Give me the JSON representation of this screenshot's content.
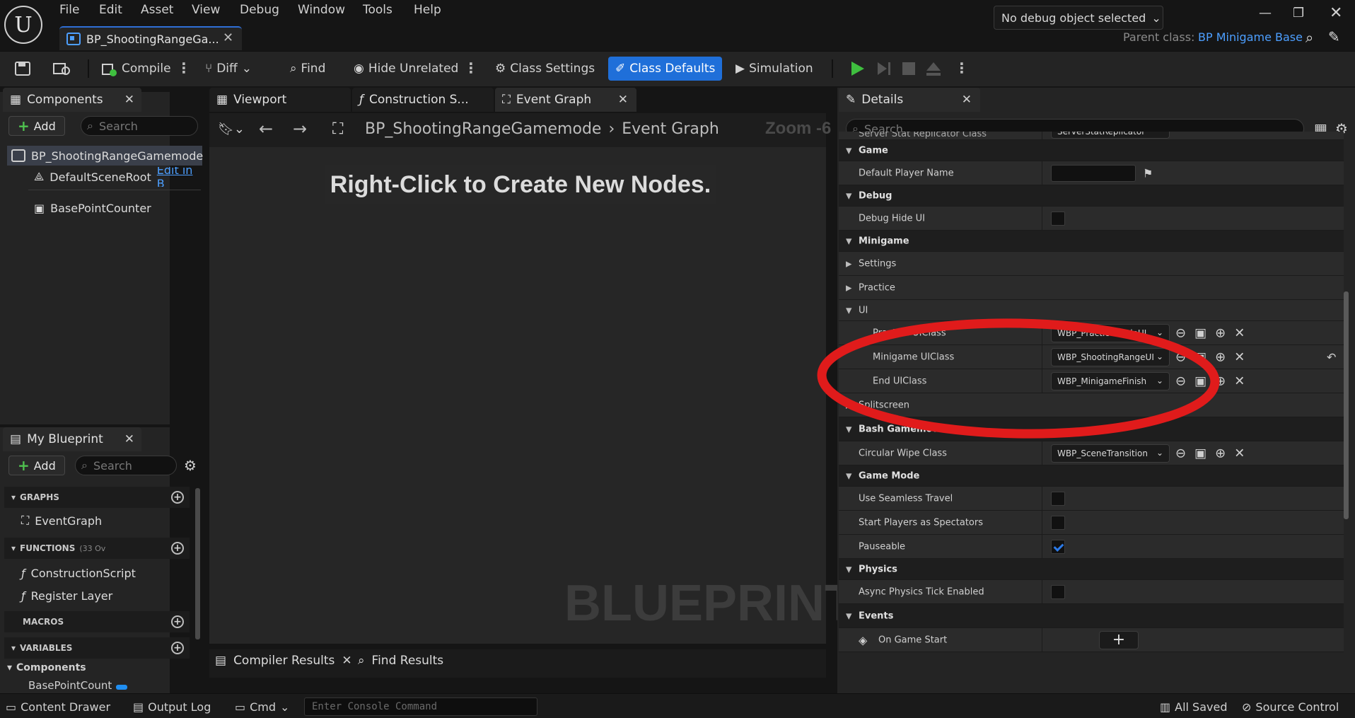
{
  "menu": [
    "File",
    "Edit",
    "Asset",
    "View",
    "Debug",
    "Window",
    "Tools",
    "Help"
  ],
  "document_tab": {
    "title": "BP_ShootingRangeGa..."
  },
  "parent_class": {
    "label": "Parent class:",
    "value": "BP Minigame Base"
  },
  "toolbar": {
    "compile": "Compile",
    "diff": "Diff",
    "find": "Find",
    "hide_unrelated": "Hide Unrelated",
    "class_settings": "Class Settings",
    "class_defaults": "Class Defaults",
    "simulation": "Simulation",
    "debug_object": "No debug object selected"
  },
  "components": {
    "tab": "Components",
    "add": "Add",
    "search_placeholder": "Search",
    "items": [
      "BP_ShootingRangeGamemode",
      "DefaultSceneRoot",
      "BasePointCounter"
    ],
    "edit_link": "Edit in B"
  },
  "my_blueprint": {
    "tab": "My Blueprint",
    "add": "Add",
    "search_placeholder": "Search",
    "graphs_label": "GRAPHS",
    "graphs": [
      "EventGraph"
    ],
    "functions_label": "FUNCTIONS",
    "functions_count": "(33 Ov",
    "functions": [
      "ConstructionScript",
      "Register Layer"
    ],
    "macros_label": "MACROS",
    "variables_label": "VARIABLES",
    "components_label": "Components",
    "component_vars": [
      "BasePointCount"
    ]
  },
  "graph_tabs": [
    "Viewport",
    "Construction S...",
    "Event Graph"
  ],
  "graph": {
    "breadcrumb_root": "BP_ShootingRangeGamemode",
    "breadcrumb_leaf": "Event Graph",
    "zoom": "Zoom -6",
    "hint": "Right-Click to Create New Nodes.",
    "watermark": "BLUEPRINT"
  },
  "bottom_tabs": [
    "Compiler Results",
    "Find Results"
  ],
  "details": {
    "tab": "Details",
    "search_placeholder": "Search",
    "rows": [
      {
        "type": "partial",
        "name": "Server Stat Replicator Class",
        "value": "ServerStatReplicator"
      },
      {
        "type": "cat",
        "name": "Game"
      },
      {
        "type": "prop",
        "name": "Default Player Name",
        "widget": "text"
      },
      {
        "type": "cat",
        "name": "Debug"
      },
      {
        "type": "prop",
        "name": "Debug Hide UI",
        "widget": "check",
        "checked": false
      },
      {
        "type": "cat",
        "name": "Minigame"
      },
      {
        "type": "sub",
        "name": "Settings"
      },
      {
        "type": "sub",
        "name": "Practice"
      },
      {
        "type": "subopen",
        "name": "UI"
      },
      {
        "type": "prop2",
        "name": "Practice UIClass",
        "widget": "combo",
        "value": "WBP_PracticeModeUI"
      },
      {
        "type": "prop2",
        "name": "Minigame UIClass",
        "widget": "combo",
        "value": "WBP_ShootingRangeUI",
        "reset": true
      },
      {
        "type": "prop2",
        "name": "End UIClass",
        "widget": "combo",
        "value": "WBP_MinigameFinish"
      },
      {
        "type": "sub",
        "name": "Splitscreen"
      },
      {
        "type": "cat",
        "name": "Bash Gamemode"
      },
      {
        "type": "prop",
        "name": "Circular Wipe Class",
        "widget": "combo",
        "value": "WBP_SceneTransition"
      },
      {
        "type": "cat",
        "name": "Game Mode"
      },
      {
        "type": "prop",
        "name": "Use Seamless Travel",
        "widget": "check",
        "checked": false
      },
      {
        "type": "prop",
        "name": "Start Players as Spectators",
        "widget": "check",
        "checked": false
      },
      {
        "type": "prop",
        "name": "Pauseable",
        "widget": "check",
        "checked": true
      },
      {
        "type": "cat",
        "name": "Physics"
      },
      {
        "type": "prop",
        "name": "Async Physics Tick Enabled",
        "widget": "check",
        "checked": false
      },
      {
        "type": "cat",
        "name": "Events"
      },
      {
        "type": "event",
        "name": "On Game Start"
      }
    ]
  },
  "statusbar": {
    "content_drawer": "Content Drawer",
    "output_log": "Output Log",
    "cmd": "Cmd",
    "console_placeholder": "Enter Console Command",
    "saved": "All Saved",
    "source_control": "Source Control"
  },
  "colors": {
    "accent": "#1f6fd9",
    "annotation": "#e01b1b",
    "link": "#4d9fff",
    "play": "#3fbf3f"
  }
}
